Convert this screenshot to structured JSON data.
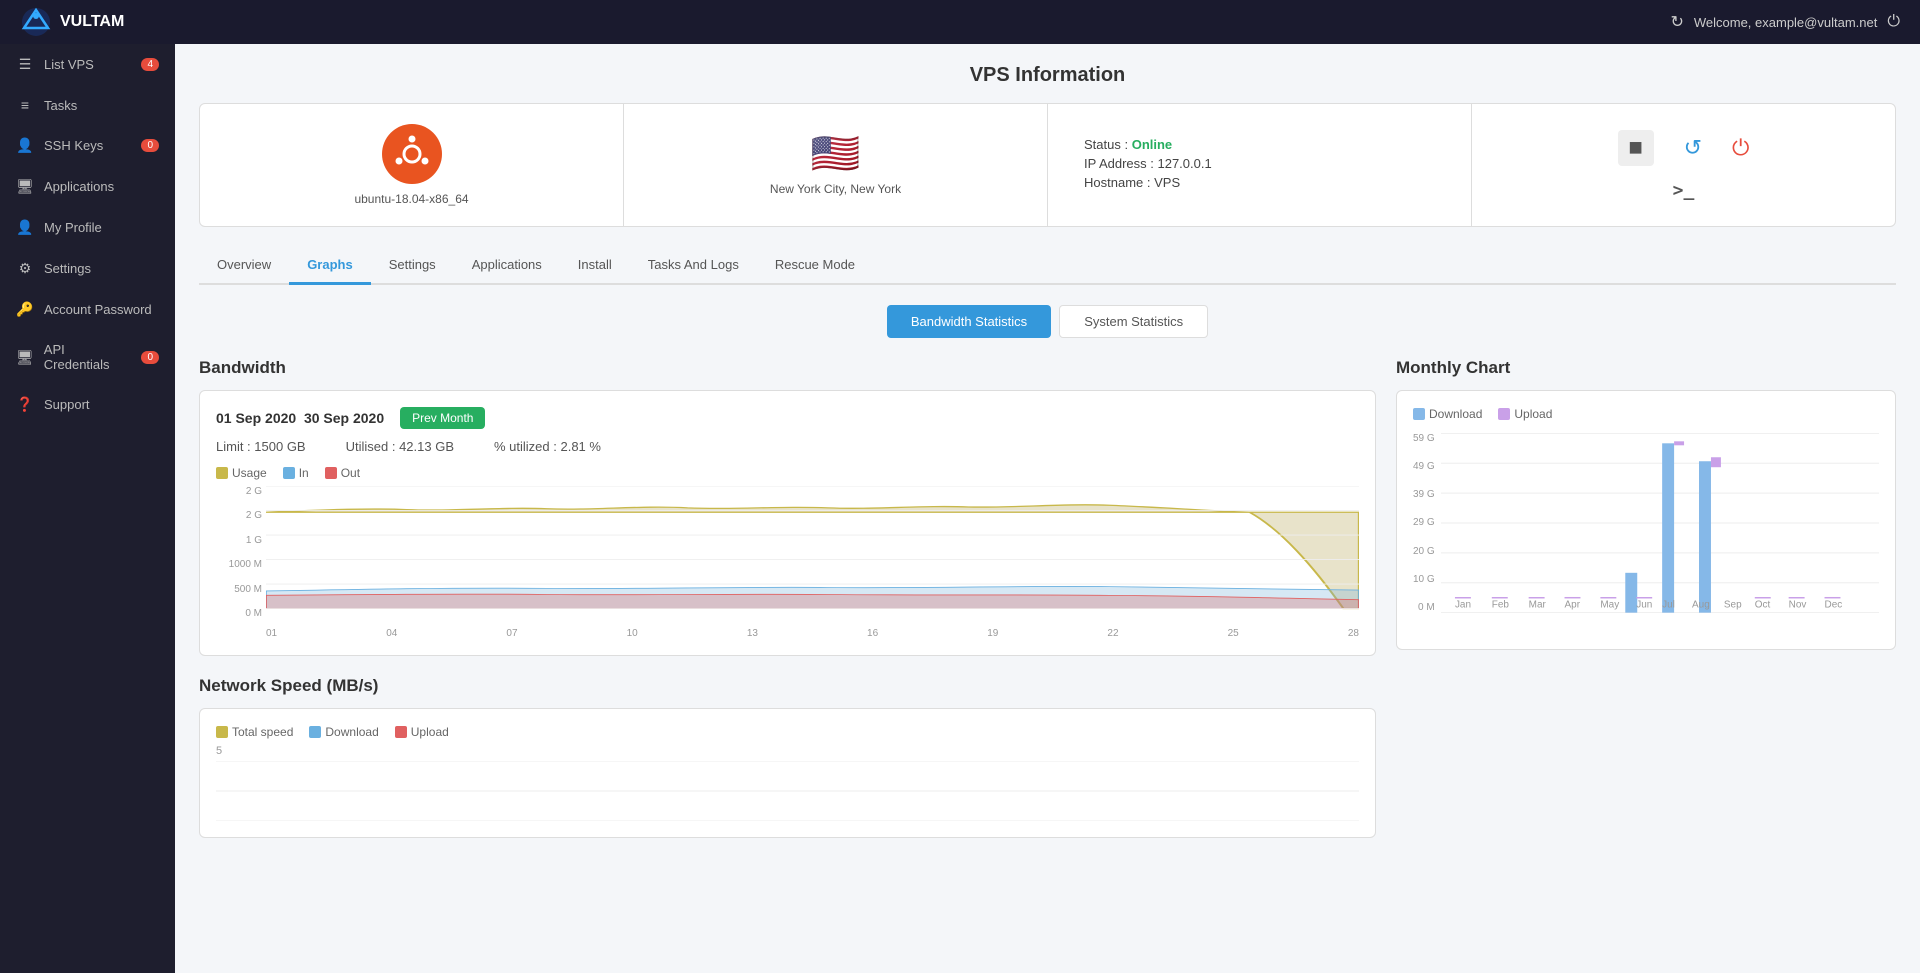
{
  "header": {
    "logo_text": "VULTAM",
    "welcome_text": "Welcome, example@vultam.net",
    "refresh_icon": "↻",
    "logout_icon": "⏻"
  },
  "sidebar": {
    "items": [
      {
        "id": "list-vps",
        "label": "List VPS",
        "icon": "☰",
        "badge": "4"
      },
      {
        "id": "tasks",
        "label": "Tasks",
        "icon": "≡",
        "badge": null
      },
      {
        "id": "ssh-keys",
        "label": "SSH Keys",
        "icon": "👤",
        "badge": "0"
      },
      {
        "id": "applications",
        "label": "Applications",
        "icon": "🖥",
        "badge": null
      },
      {
        "id": "my-profile",
        "label": "My Profile",
        "icon": "👤",
        "badge": null
      },
      {
        "id": "settings",
        "label": "Settings",
        "icon": "⚙",
        "badge": null
      },
      {
        "id": "account-password",
        "label": "Account Password",
        "icon": "🔑",
        "badge": null
      },
      {
        "id": "api-credentials",
        "label": "API Credentials",
        "icon": "🖥",
        "badge": "0"
      },
      {
        "id": "support",
        "label": "Support",
        "icon": "❓",
        "badge": null
      }
    ]
  },
  "page": {
    "title": "VPS Information"
  },
  "vps_info": {
    "os_name": "ubuntu-18.04-x86_64",
    "location": "New York City, New York",
    "status_label": "Status :",
    "status_value": "Online",
    "ip_label": "IP Address :",
    "ip_value": "127.0.0.1",
    "hostname_label": "Hostname :",
    "hostname_value": "VPS"
  },
  "tabs": [
    {
      "id": "overview",
      "label": "Overview",
      "active": false
    },
    {
      "id": "graphs",
      "label": "Graphs",
      "active": true
    },
    {
      "id": "settings",
      "label": "Settings",
      "active": false
    },
    {
      "id": "applications",
      "label": "Applications",
      "active": false
    },
    {
      "id": "install",
      "label": "Install",
      "active": false
    },
    {
      "id": "tasks-and-logs",
      "label": "Tasks And Logs",
      "active": false
    },
    {
      "id": "rescue-mode",
      "label": "Rescue Mode",
      "active": false
    }
  ],
  "stats_buttons": {
    "bandwidth": "Bandwidth Statistics",
    "system": "System Statistics"
  },
  "bandwidth": {
    "section_title": "Bandwidth",
    "date_start": "01 Sep 2020",
    "date_end": "30 Sep 2020",
    "prev_month_btn": "Prev Month",
    "limit_label": "Limit : 1500 GB",
    "utilised_label": "Utilised : 42.13 GB",
    "utilized_pct": "% utilized : 2.81 %",
    "legend": [
      {
        "label": "Usage",
        "color": "#c8b84a"
      },
      {
        "label": "In",
        "color": "#6ab0e0"
      },
      {
        "label": "Out",
        "color": "#e06060"
      }
    ],
    "y_labels": [
      "2 G",
      "2 G",
      "1 G",
      "1000 M",
      "500 M",
      "0 M"
    ],
    "x_labels": [
      "01",
      "04",
      "07",
      "10",
      "13",
      "16",
      "19",
      "22",
      "25",
      "28"
    ]
  },
  "monthly_chart": {
    "section_title": "Monthly Chart",
    "legend": [
      {
        "label": "Download",
        "color": "#85b8e8"
      },
      {
        "label": "Upload",
        "color": "#c9a0e8"
      }
    ],
    "y_labels": [
      "59 G",
      "49 G",
      "39 G",
      "29 G",
      "20 G",
      "10 G",
      "0 M"
    ],
    "months": [
      "Jan",
      "Feb",
      "Mar",
      "Apr",
      "May",
      "Jun",
      "Jul",
      "Aug",
      "Sep",
      "Oct",
      "Nov",
      "Dec"
    ],
    "download_values": [
      0,
      0,
      0,
      0,
      0,
      0,
      12,
      50,
      45,
      0,
      0,
      0
    ],
    "upload_values": [
      0,
      0,
      0,
      0,
      0,
      0,
      0,
      4,
      6,
      0,
      0,
      0
    ]
  },
  "network_speed": {
    "section_title": "Network Speed (MB/s)",
    "legend": [
      {
        "label": "Total speed",
        "color": "#c8b84a"
      },
      {
        "label": "Download",
        "color": "#6ab0e0"
      },
      {
        "label": "Upload",
        "color": "#e06060"
      }
    ],
    "y_label_top": "5"
  }
}
